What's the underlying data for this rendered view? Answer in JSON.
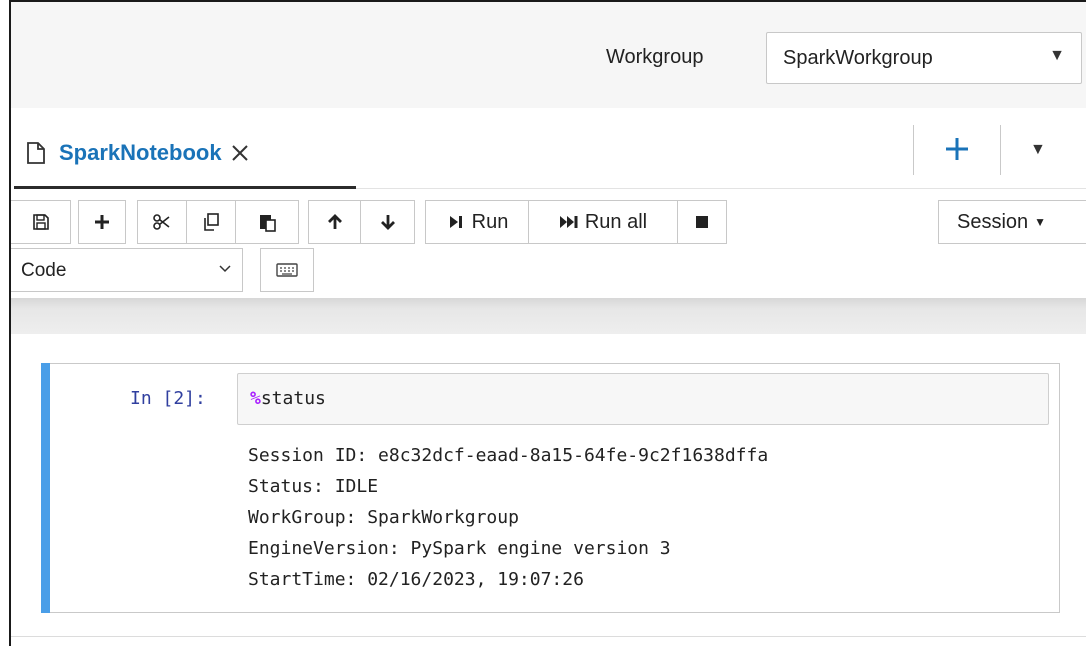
{
  "header": {
    "workgroup_label": "Workgroup",
    "workgroup_value": "SparkWorkgroup"
  },
  "tabs": [
    {
      "label": "SparkNotebook",
      "active": true
    }
  ],
  "toolbar": {
    "icons": [
      "save-icon",
      "add-cell-icon",
      "cut-icon",
      "copy-icon",
      "paste-icon",
      "move-up-icon",
      "move-down-icon",
      "stop-icon"
    ],
    "run_label": "Run",
    "run_all_label": "Run all",
    "session_label": "Session",
    "cell_type": "Code"
  },
  "cell": {
    "prompt": "In [2]:",
    "magic_prefix": "%",
    "code_rest": "status",
    "output_lines": [
      "Session ID: e8c32dcf-eaad-8a15-64fe-9c2f1638dffa",
      "Status: IDLE",
      "WorkGroup: SparkWorkgroup",
      "EngineVersion: PySpark engine version 3",
      "StartTime: 02/16/2023, 19:07:26"
    ]
  },
  "colors": {
    "accent_blue": "#1a73b8",
    "cell_accent": "#4a9ee8",
    "magic_purple": "#aa22ff",
    "prompt_blue": "#303f9f"
  }
}
